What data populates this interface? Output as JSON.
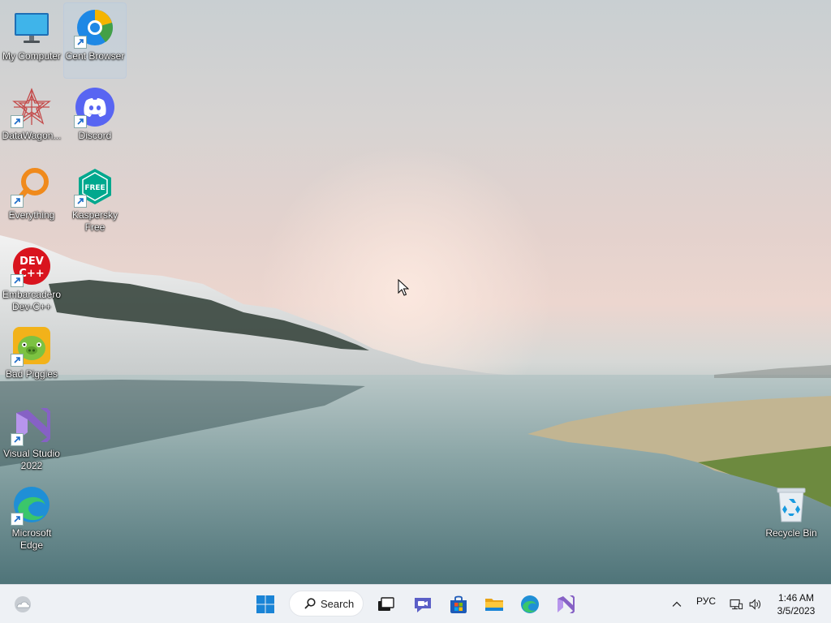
{
  "desktop": {
    "icons": [
      {
        "label": "My Computer",
        "icon": "monitor-icon"
      },
      {
        "label": "Cent Browser",
        "icon": "cent-browser-icon"
      },
      {
        "label": "DataWagon...",
        "icon": "datawagon-icon"
      },
      {
        "label": "Discord",
        "icon": "discord-icon"
      },
      {
        "label": "Everything",
        "icon": "everything-icon"
      },
      {
        "label": "Kaspersky Free",
        "icon": "kaspersky-icon",
        "badge": "FREE"
      },
      {
        "label": "Embarcadero Dev-C++",
        "icon": "devcpp-icon",
        "badge": "DEV C++"
      },
      {
        "label": "Bad Piggies",
        "icon": "bad-piggies-icon"
      },
      {
        "label": "Visual Studio 2022",
        "icon": "visual-studio-icon"
      },
      {
        "label": "Microsoft Edge",
        "icon": "edge-icon"
      },
      {
        "label": "Recycle Bin",
        "icon": "recycle-bin-icon"
      }
    ]
  },
  "taskbar": {
    "search_label": "Search",
    "tray": {
      "language": "РУС",
      "time": "1:46 AM",
      "date": "3/5/2023"
    }
  },
  "colors": {
    "taskbar_bg": "#eef1f5",
    "discord": "#5865f2",
    "vs_purple": "#8661c5",
    "dev_red": "#d9141e",
    "kaspersky": "#00a88e",
    "everything_orange": "#f08a1c"
  }
}
